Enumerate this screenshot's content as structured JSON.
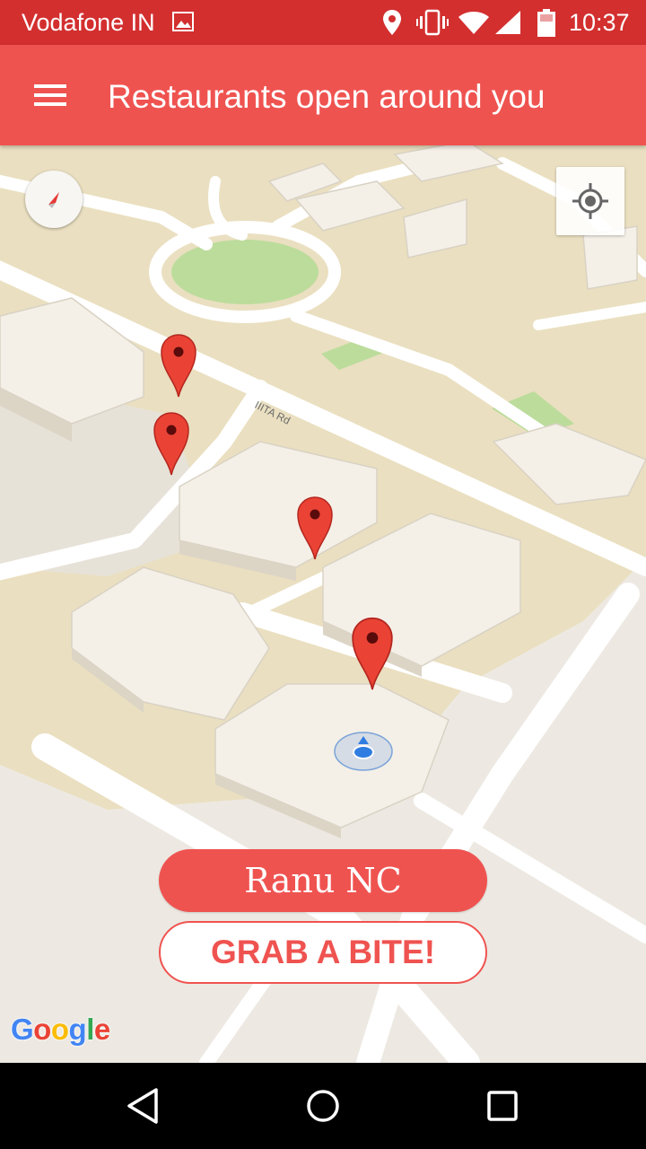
{
  "status_bar": {
    "carrier": "Vodafone IN",
    "time": "10:37",
    "icons": [
      "image-icon",
      "location-pin-icon",
      "vibrate-icon",
      "wifi-icon",
      "cell-signal-icon",
      "battery-icon"
    ]
  },
  "app_bar": {
    "menu_icon": "hamburger-menu-icon",
    "title": "Restaurants open around you"
  },
  "map": {
    "road_label": "IIITA Rd",
    "compass_icon": "compass-icon",
    "locate_icon": "my-location-icon",
    "restaurant_markers": 4,
    "marker_color": "#ea4335",
    "attribution": "Google",
    "google_letters": [
      "G",
      "o",
      "o",
      "g",
      "l",
      "e"
    ],
    "google_colors": [
      "#4285f4",
      "#ea4335",
      "#fbbc05",
      "#4285f4",
      "#34a853",
      "#ea4335"
    ]
  },
  "actions": {
    "restaurant_name": "Ranu NC",
    "grab_label": "GRAB A BITE!"
  },
  "nav_bar": {
    "back_icon": "back-triangle-icon",
    "home_icon": "home-circle-icon",
    "recents_icon": "recents-square-icon"
  },
  "colors": {
    "status_bar": "#d32f2f",
    "app_bar": "#ef5350",
    "accent": "#ef5350",
    "map_land": "#ede9e2",
    "map_campus": "#eadfc0",
    "park_green": "#bcdc9c"
  }
}
